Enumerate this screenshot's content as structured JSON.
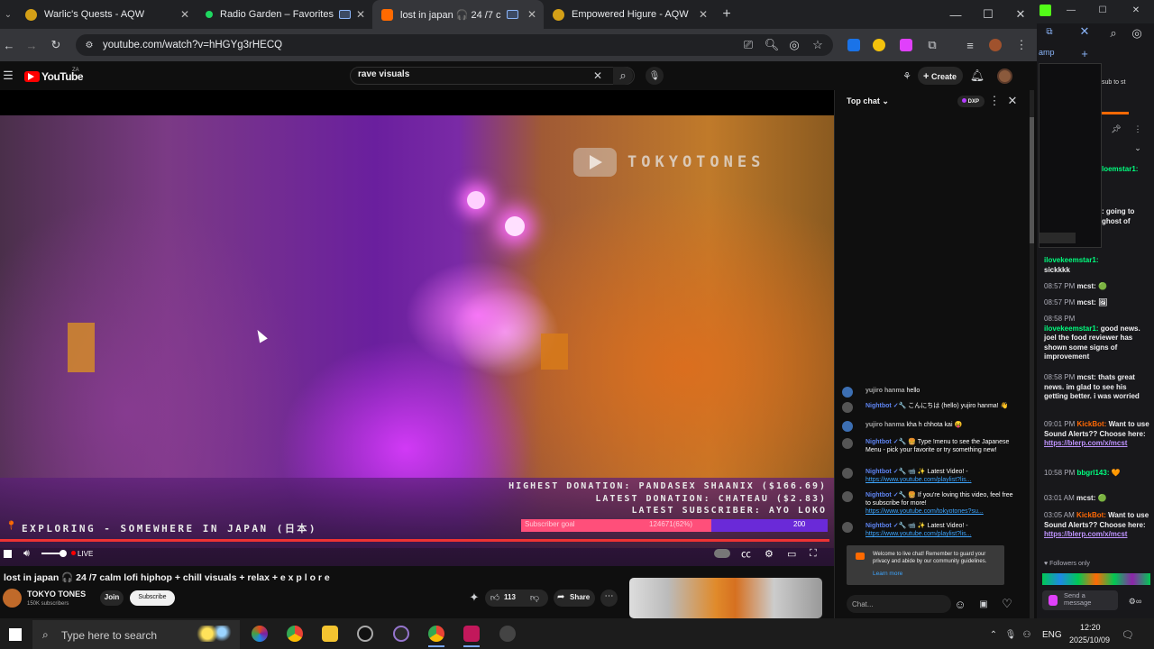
{
  "browser": {
    "tabs": [
      {
        "title": "Warlic's Quests - AQW",
        "color": "#d4a017"
      },
      {
        "title": "Radio Garden – Favorites",
        "color": "#1ed760"
      },
      {
        "title": "lost in japan 🎧 24 /7 c",
        "color": "#ff6a00"
      },
      {
        "title": "Empowered Higure - AQW",
        "color": "#d4a017"
      }
    ],
    "url": "youtube.com/watch?v=hHGYg3rHECQ"
  },
  "youtube": {
    "logo": "YouTube",
    "region": "ZA",
    "search_value": "rave visuals",
    "create_label": "Create"
  },
  "video": {
    "watermark": "TOKYOTONES",
    "highest_donation": "HIGHEST DONATION: PANDASEX SHAANIX ($166.69)",
    "latest_donation": "LATEST DONATION: CHATEAU ($2.83)",
    "latest_subscriber": "LATEST SUBSCRIBER: AYO LOKO",
    "exploring": "EXPLORING - SOMEWHERE IN JAPAN (日本)",
    "goal_label": "Subscriber goal",
    "goal_value": "124671(62%)",
    "goal_target": "200",
    "goal_fraction": 0.62,
    "live_label": "LIVE",
    "title": "lost in japan 🎧 24 /7 calm lofi hiphop + chill visuals + relax + e x p l o r e",
    "channel": "TOKYO TONES",
    "subscribers": "150K subscribers",
    "join_label": "Join",
    "subscribe_label": "Subscribe",
    "likes": "113",
    "share_label": "Share"
  },
  "chat": {
    "title": "Top chat",
    "badge": "DXP",
    "messages": [
      {
        "name": "yujiro hanma",
        "text": "hello",
        "link": ""
      },
      {
        "name": "Nightbot ✓🔧",
        "text": "こんにちは (hello) yujiro hanma! 👋",
        "link": ""
      },
      {
        "name": "yujiro hanma",
        "text": "kha h chhota kai 😝",
        "link": ""
      },
      {
        "name": "Nightbot ✓🔧",
        "text": "🍔 Type !menu to see the Japanese Menu - pick your favorite or try something new!",
        "link": ""
      },
      {
        "name": "Nightbot ✓🔧",
        "text": "📹 ✨ Latest Video! -",
        "link": "https://www.youtube.com/playlist?lis..."
      },
      {
        "name": "Nightbot ✓🔧",
        "text": "🍔 If you're loving this video, feel free to subscribe for more!",
        "link": "https://www.youtube.com/tokyotones?su..."
      },
      {
        "name": "Nightbot ✓🔧",
        "text": "📹 ✨ Latest Video! -",
        "link": "https://www.youtube.com/playlist?lis..."
      }
    ],
    "welcome": "Welcome to live chat! Remember to guard your privacy and abide by our community guidelines.",
    "learn_more": "Learn more",
    "input_placeholder": "Chat..."
  },
  "twitch": {
    "partial_top": "amp",
    "sub_text": "sub to st",
    "top_frag1": "loemstar1:",
    "top_frag2": ": going to",
    "top_frag3": "ghost of",
    "messages": [
      {
        "time": "",
        "user": "ilovekeemstar1:",
        "text": "sickkkk"
      },
      {
        "time": "08:57 PM",
        "user": "mcst:",
        "text": "🟢"
      },
      {
        "time": "08:57 PM",
        "user": "mcst:",
        "text": "🖼"
      },
      {
        "time": "08:58 PM",
        "user": "ilovekeemstar1:",
        "text": "good news. joel the food reviewer has shown some signs of improvement"
      },
      {
        "time": "08:58 PM",
        "user": "mcst:",
        "text": "thats great news. im glad to see his getting better. i was worried"
      },
      {
        "time": "09:01 PM",
        "user": "KickBot:",
        "text": "Want to use Sound Alerts?? Choose here:",
        "link": "https://blerp.com/x/mcst"
      },
      {
        "time": "10:58 PM",
        "user": "bbgrl143:",
        "text": "🧡"
      },
      {
        "time": "03:01 AM",
        "user": "mcst:",
        "text": "🟢"
      },
      {
        "time": "03:05 AM",
        "user": "KickBot:",
        "text": "Want to use Sound Alerts?? Choose here:",
        "link": "https://blerp.com/x/mcst"
      }
    ],
    "followers_only": "Followers only",
    "send_placeholder": "Send a message"
  },
  "taskbar": {
    "search_placeholder": "Type here to search",
    "lang": "ENG",
    "time": "12:20",
    "date": "2025/10/09"
  }
}
